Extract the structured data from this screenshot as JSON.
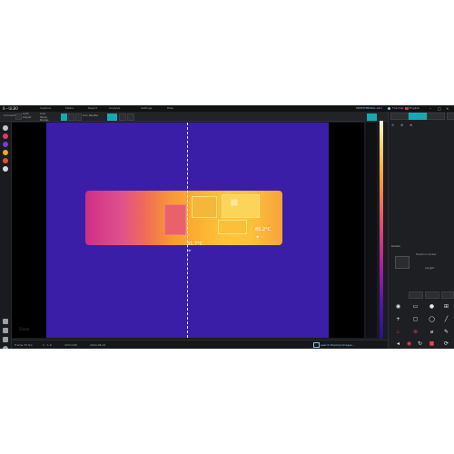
{
  "window": {
    "logo": "ß···ULB0",
    "menu": [
      "Capture",
      "Media",
      "Report",
      "Analysis",
      "Settings",
      "Help"
    ],
    "status_link": "SEEKTHERMAL-ALU",
    "user_label": "Thermal",
    "lang_label": "English"
  },
  "toolbar": {
    "connect_label": "Connected",
    "mode_label": "Auto Adjust",
    "range_label": "Low Temp Range",
    "palette_label": "Iron Palette",
    "view_tabs": [
      "Live",
      "Freeze"
    ]
  },
  "viewer": {
    "cold_spot": "31.7°C",
    "hot_spot": "85.2°C",
    "watermark": "Sirale"
  },
  "right_panel": {
    "tabs": [
      "Live",
      "Camera",
      "Analyze"
    ],
    "section_label": "Cursor",
    "position_label": "Position Center",
    "size_label": "Length"
  },
  "status": {
    "fps": "Frame 30 fps",
    "zoom": "1 : 1.0",
    "resolution": "320×240",
    "timestamp": "2024-06-01",
    "search_hint": "search thermal images..."
  },
  "colors": {
    "accent": "#17a9b1",
    "background": "#1b1c1f",
    "hot": "#fdc43e",
    "cold": "#3a1ea8"
  }
}
